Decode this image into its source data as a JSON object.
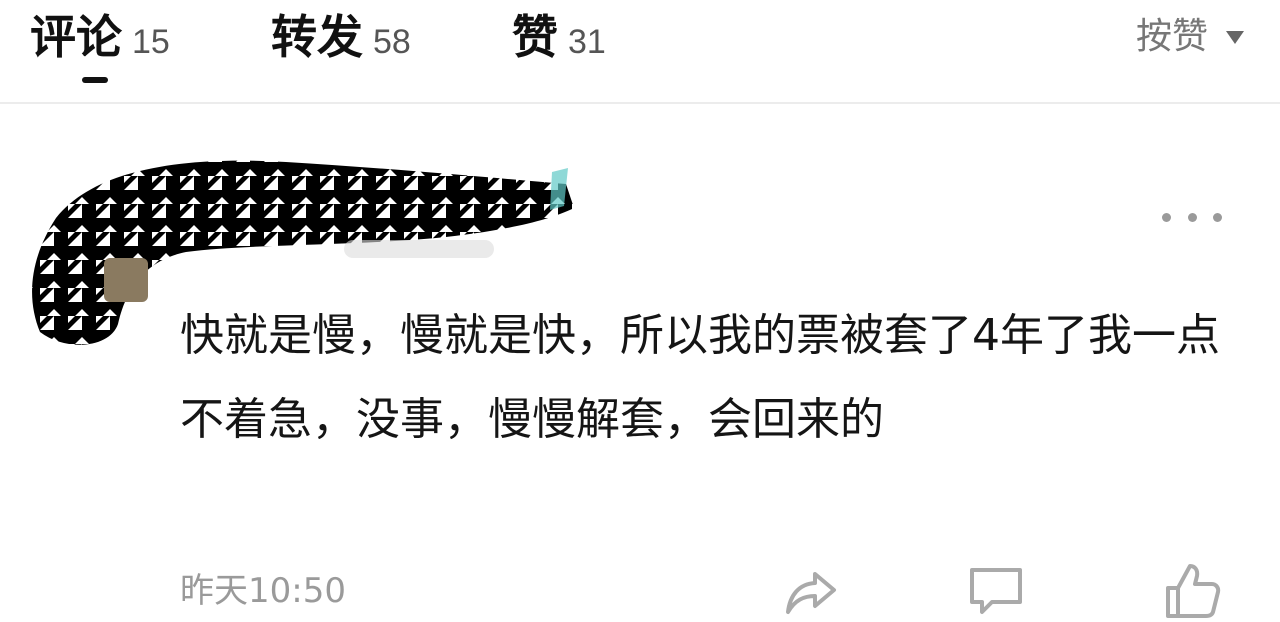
{
  "tabs": [
    {
      "label": "评论",
      "count": "15",
      "active": true
    },
    {
      "label": "转发",
      "count": "58"
    },
    {
      "label": "赞",
      "count": "31"
    }
  ],
  "sort": {
    "label": "按赞",
    "icon": "caret-down-icon"
  },
  "comment": {
    "text": "快就是慢，慢就是快，所以我的票被套了4年了我一点不着急，没事，慢慢解套，会回来的",
    "time": "昨天10:50",
    "actions": [
      "share-icon",
      "comment-icon",
      "like-icon"
    ]
  },
  "colors": {
    "text": "#111111",
    "muted": "#9a9a9a",
    "divider": "#ececec"
  }
}
